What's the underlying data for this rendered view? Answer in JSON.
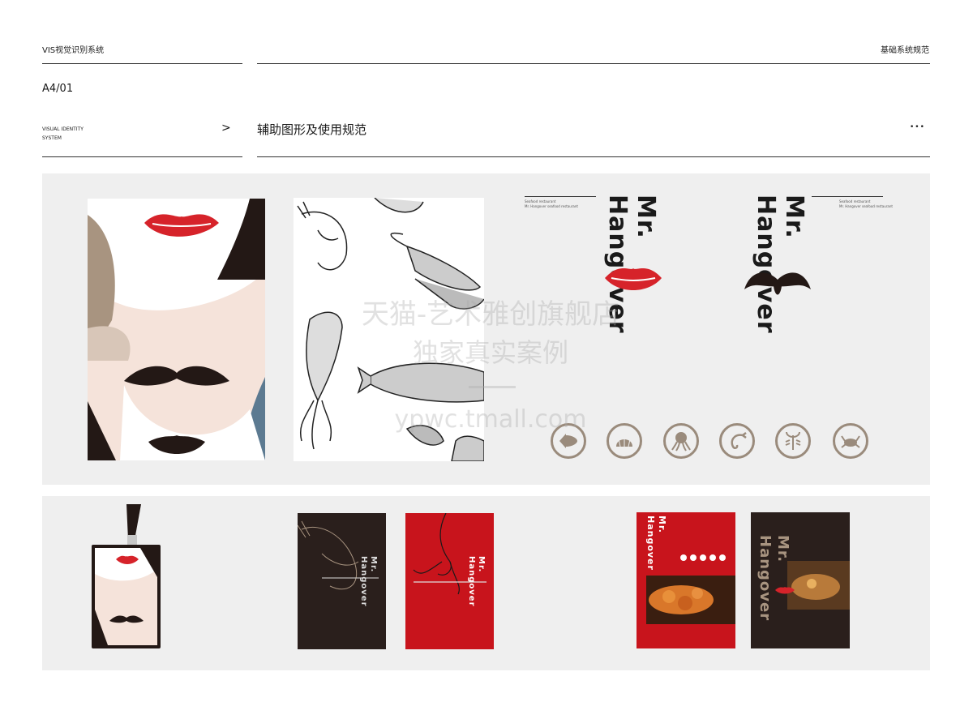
{
  "header": {
    "left_title": "VIS视觉识别系统",
    "right_title": "基础系统规范",
    "page_code": "A4/01",
    "subtitle_line1": "VISUAL IDENTITY",
    "subtitle_line2": "SYSTEM",
    "arrow": ">",
    "section_title": "辅助图形及使用规范",
    "more": "•••"
  },
  "brand": {
    "name_line1": "Mr.",
    "name_line2": "Hangover",
    "small_caption_line1": "Seafood restaurant",
    "small_caption_line2": "Mr. Hangover seafood restaurant"
  },
  "icons": [
    "fish-icon",
    "shell-icon",
    "octopus-icon",
    "shrimp-icon",
    "lobster-icon",
    "crab-icon"
  ],
  "watermark": {
    "line1": "天猫-艺术雅创旗舰店",
    "line2": "独家真实案例",
    "line3": "ypwc.tmall.com"
  },
  "colors": {
    "accent_red": "#d6232a",
    "dark": "#231815",
    "panel": "#efefef",
    "icon_brown": "#9a8b7c"
  }
}
